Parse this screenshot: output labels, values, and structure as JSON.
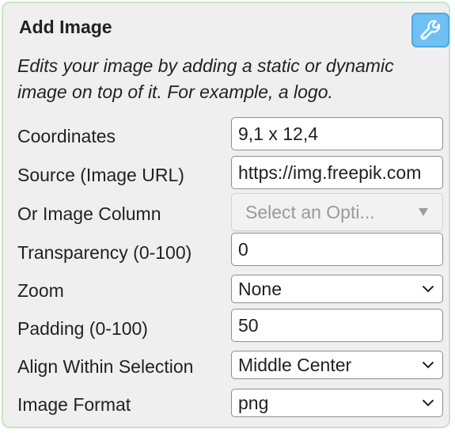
{
  "panel": {
    "title": "Add Image",
    "wrench_button_icon": "wrench-icon",
    "description": "Edits your image by adding a static or dynamic image on top of it. For example, a logo."
  },
  "fields": {
    "coordinates": {
      "label": "Coordinates",
      "value": "9,1 x 12,4"
    },
    "source": {
      "label": "Source (Image URL)",
      "value": "https://img.freepik.com"
    },
    "image_column": {
      "label": "Or Image Column",
      "placeholder": "Select an Opti..."
    },
    "transparency": {
      "label": "Transparency (0-100)",
      "value": "0"
    },
    "zoom": {
      "label": "Zoom",
      "value": "None"
    },
    "padding": {
      "label": "Padding (0-100)",
      "value": "50"
    },
    "align": {
      "label": "Align Within Selection",
      "value": "Middle Center"
    },
    "format": {
      "label": "Image Format",
      "value": "png"
    }
  },
  "colors": {
    "panel_border": "#c9e6c2",
    "panel_background": "#efefef",
    "accent_button": "#6ec1f2"
  }
}
